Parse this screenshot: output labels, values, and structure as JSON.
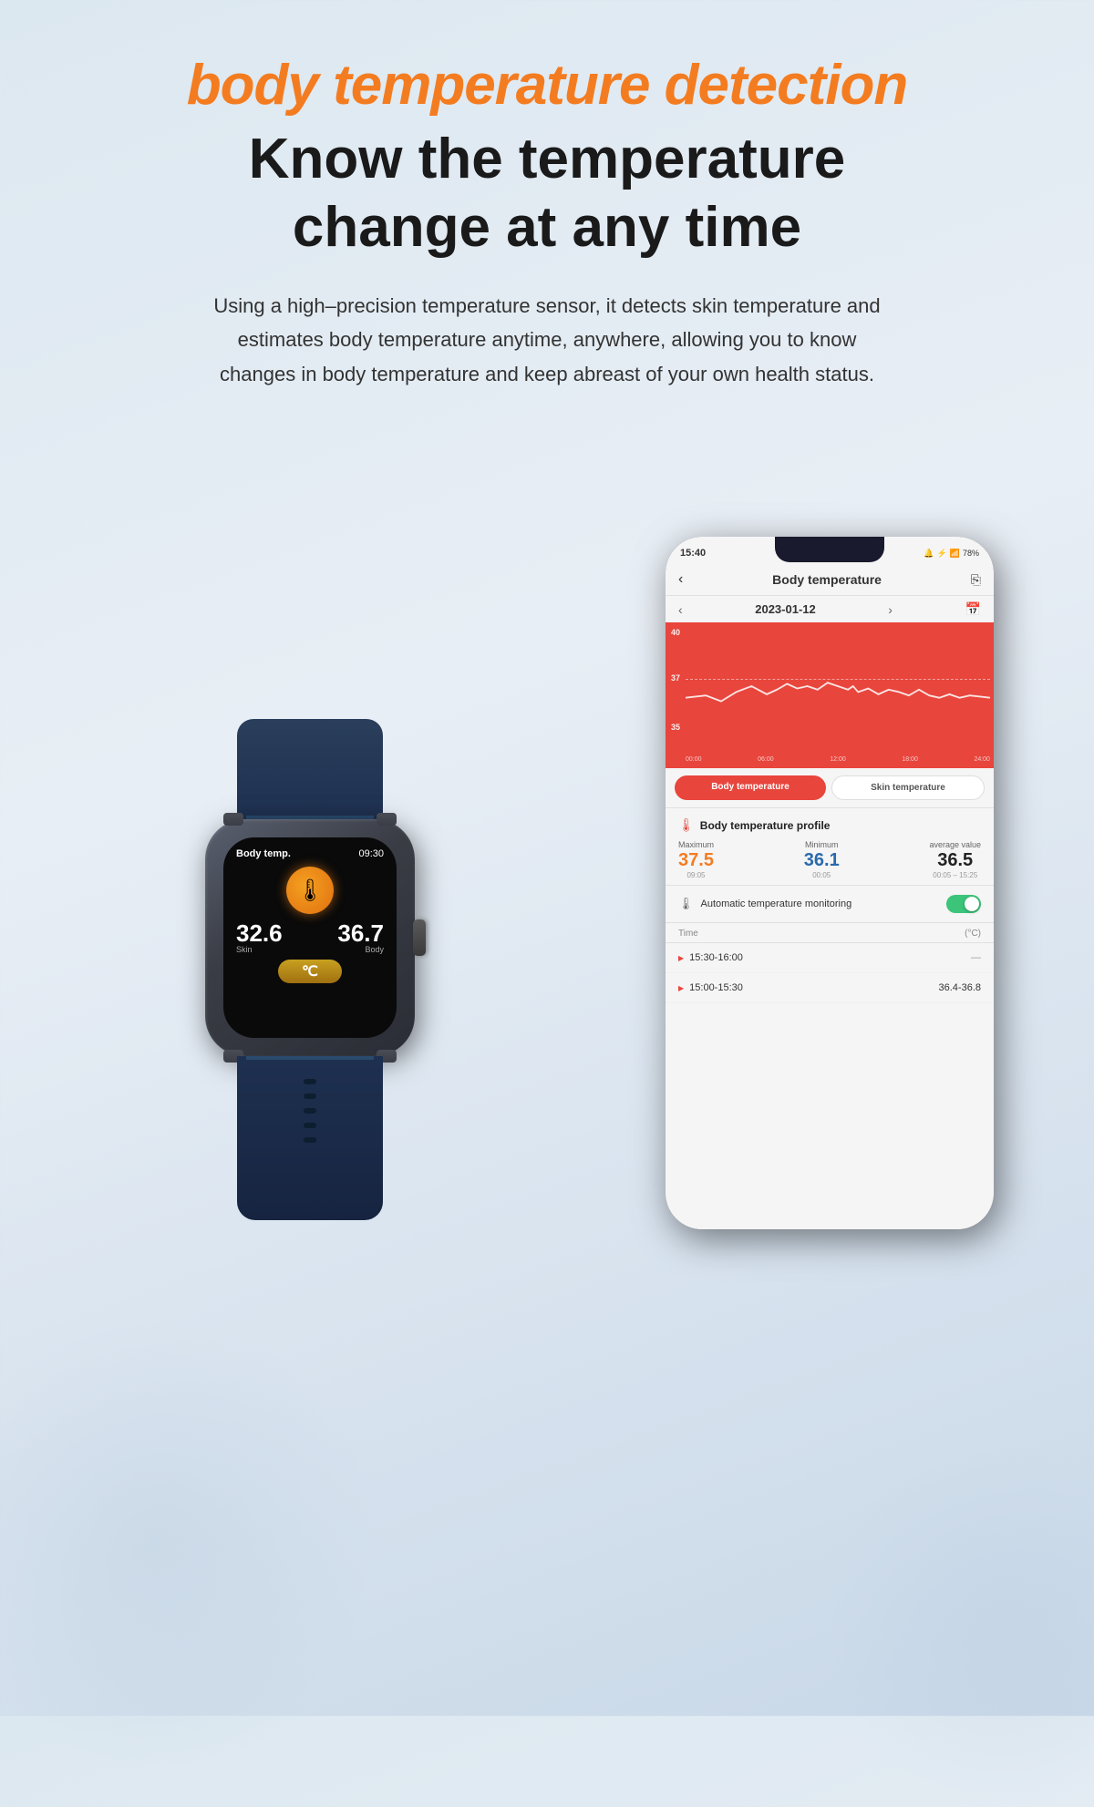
{
  "header": {
    "orange_title": "body temperature detection",
    "black_title_line1": "Know the temperature",
    "black_title_line2": "change at any time",
    "description": "Using a high–precision temperature sensor, it detects skin temperature and estimates body temperature anytime, anywhere, allowing you to know changes in body temperature and keep abreast of your own health status."
  },
  "watch": {
    "title": "Body temp.",
    "time": "09:30",
    "skin_temp": "32.6",
    "skin_label": "Skin",
    "body_temp": "36.7",
    "body_label": "Body"
  },
  "phone": {
    "status_bar": {
      "time": "15:40",
      "battery": "78%",
      "signal": "📶"
    },
    "app_header": {
      "back": "‹",
      "title": "Body temperature",
      "share": "⎘"
    },
    "date_nav": {
      "prev": "‹",
      "date": "2023-01-12",
      "next": "›",
      "calendar": "📅"
    },
    "chart": {
      "y_labels": [
        "40",
        "37",
        "35"
      ],
      "x_labels": [
        "00:00",
        "06:00",
        "12:00",
        "18:00",
        "24:00"
      ]
    },
    "tabs": {
      "active": "Body temperature",
      "inactive": "Skin temperature"
    },
    "profile": {
      "title": "Body temperature profile",
      "maximum_label": "Maximum",
      "minimum_label": "Minimum",
      "average_label": "average value",
      "maximum_value": "37.5",
      "maximum_time": "09:05",
      "minimum_value": "36.1",
      "minimum_time": "00:05",
      "average_value": "36.5",
      "average_time": "00:05 – 15:25"
    },
    "auto_monitoring": {
      "icon": "🌡",
      "label": "Automatic temperature\nmonitoring"
    },
    "table_header": {
      "time_col": "Time",
      "unit_col": "(°C)"
    },
    "rows": [
      {
        "time": "15:30-16:00",
        "value": "—"
      },
      {
        "time": "15:00-15:30",
        "value": "36.4-36.8"
      }
    ]
  }
}
